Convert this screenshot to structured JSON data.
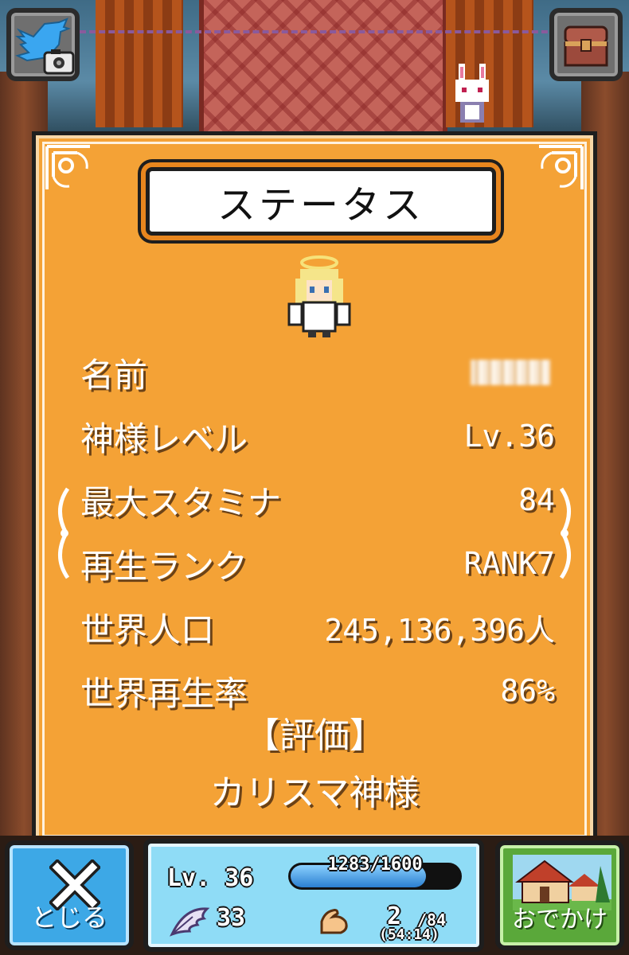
{
  "screen": {
    "title": "ステータス",
    "stats": [
      {
        "label": "名前",
        "value": ""
      },
      {
        "label": "神様レベル",
        "value": "Lv.36"
      },
      {
        "label": "最大スタミナ",
        "value": "84"
      },
      {
        "label": "再生ランク",
        "value": "RANK7"
      },
      {
        "label": "世界人口",
        "value": "245,136,396人"
      },
      {
        "label": "世界再生率",
        "value": "86%"
      }
    ],
    "evaluation_heading": "【評価】",
    "evaluation_value": "カリスマ神様"
  },
  "top_bar": {
    "left_icon": "twitter-camera-icon",
    "right_icon": "treasure-chest-icon"
  },
  "bottom_bar": {
    "close_label": "とじる",
    "outing_label": "おでかけ",
    "player": {
      "level_label": "Lv. 36",
      "exp_text": "1283/1600",
      "exp_fraction": 0.8,
      "feathers": "33",
      "stamina_current": "2",
      "stamina_max": "/84",
      "stamina_timer": "(54:14)"
    }
  },
  "colors": {
    "panel": "#f4a236",
    "close_button": "#3da8e6",
    "outing_button": "#5aa83a",
    "player_panel": "#8fdcf6"
  }
}
